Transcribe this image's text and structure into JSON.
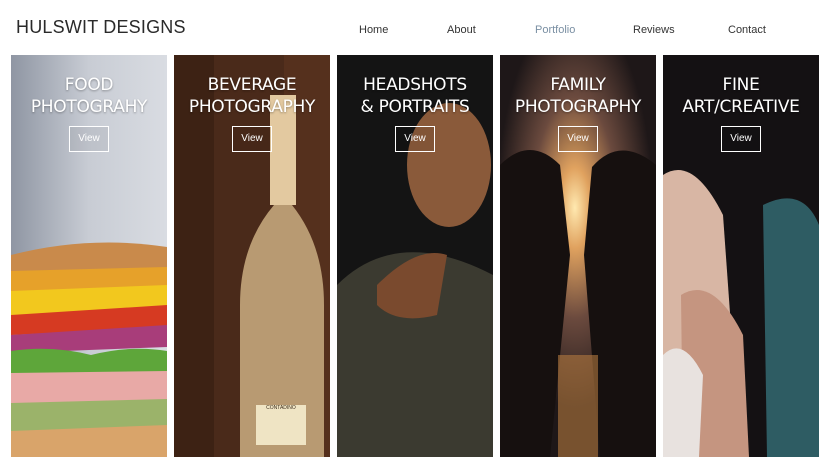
{
  "header": {
    "logo": "HULSWIT DESIGNS",
    "nav": [
      {
        "label": "Home"
      },
      {
        "label": "About"
      },
      {
        "label": "Portfolio",
        "active": true
      },
      {
        "label": "Reviews"
      },
      {
        "label": "Contact"
      }
    ]
  },
  "panels": [
    {
      "line1": "FOOD",
      "line2": "PHOTOGRAHY",
      "button": "View"
    },
    {
      "line1": "BEVERAGE",
      "line2": "PHOTOGRAPHY",
      "button": "View"
    },
    {
      "line1": "HEADSHOTS",
      "line2": "& PORTRAITS",
      "button": "View"
    },
    {
      "line1": "FAMILY",
      "line2": "PHOTOGRAPHY",
      "button": "View"
    },
    {
      "line1": "FINE",
      "line2": "ART/CREATIVE",
      "button": "View"
    }
  ],
  "bottle_label": "CONTADINO",
  "colors": {
    "nav_active": "#7a8fa3",
    "text": "#333333",
    "background": "#ffffff"
  }
}
